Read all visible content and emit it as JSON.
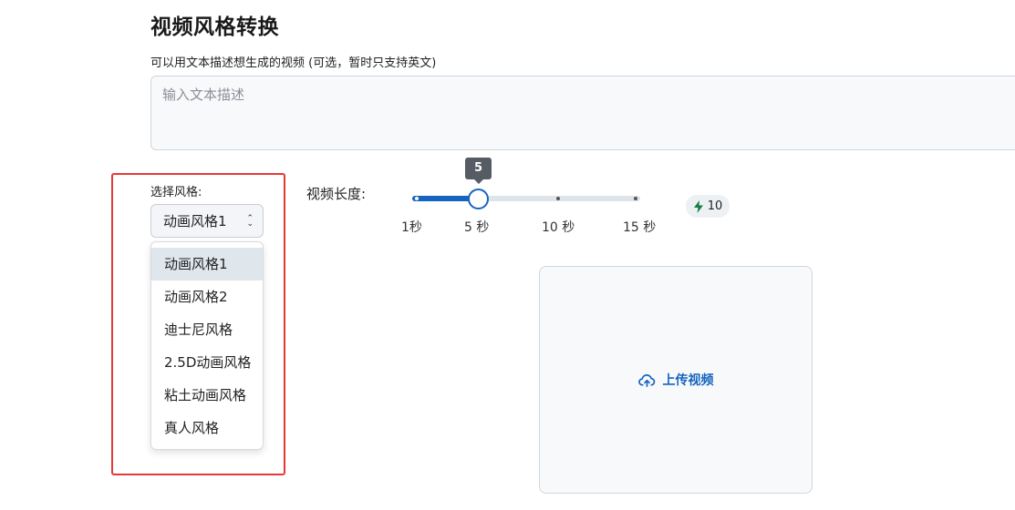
{
  "page": {
    "title": "视频风格转换"
  },
  "description": {
    "label": "可以用文本描述想生成的视频 (可选，暂时只支持英文)",
    "placeholder": "输入文本描述",
    "value": ""
  },
  "style": {
    "label": "选择风格:",
    "selected": "动画风格1",
    "options": [
      "动画风格1",
      "动画风格2",
      "迪士尼风格",
      "2.5D动画风格",
      "粘土动画风格",
      "真人风格"
    ]
  },
  "length": {
    "label": "视频长度:",
    "value": 5,
    "value_label": "5",
    "min": 1,
    "max": 15,
    "ticks": [
      {
        "value": 1,
        "label": "1秒"
      },
      {
        "value": 5,
        "label": "5 秒"
      },
      {
        "value": 10,
        "label": "10 秒"
      },
      {
        "value": 15,
        "label": "15 秒"
      }
    ]
  },
  "credits": {
    "icon": "lightning-bolt-icon",
    "value": "10",
    "color": "#1b7a3e"
  },
  "upload": {
    "icon": "cloud-upload-icon",
    "label": "上传视频"
  },
  "colors": {
    "accent": "#1565c0",
    "highlight_border": "#e53935"
  }
}
